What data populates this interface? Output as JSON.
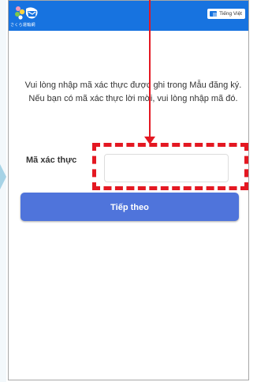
{
  "header": {
    "logo_text": "さくら運輸網",
    "language_button_label": "Tiếng Việt",
    "language_icon": "translate-icon",
    "logo_icon": "sakura-logo"
  },
  "main": {
    "instruction_line1": "Vui lòng nhập mã xác thực được ghi trong Mẫu đăng ký.",
    "instruction_line2": "Nếu bạn có mã xác thực lời mời, vui lòng nhập mã đó.",
    "code_label": "Mã xác thực",
    "code_value": "",
    "code_placeholder": "",
    "next_button_label": "Tiếp theo"
  },
  "colors": {
    "app_bar": "#1773e0",
    "primary_button": "#4f74db",
    "annotation_red": "#e41822"
  }
}
